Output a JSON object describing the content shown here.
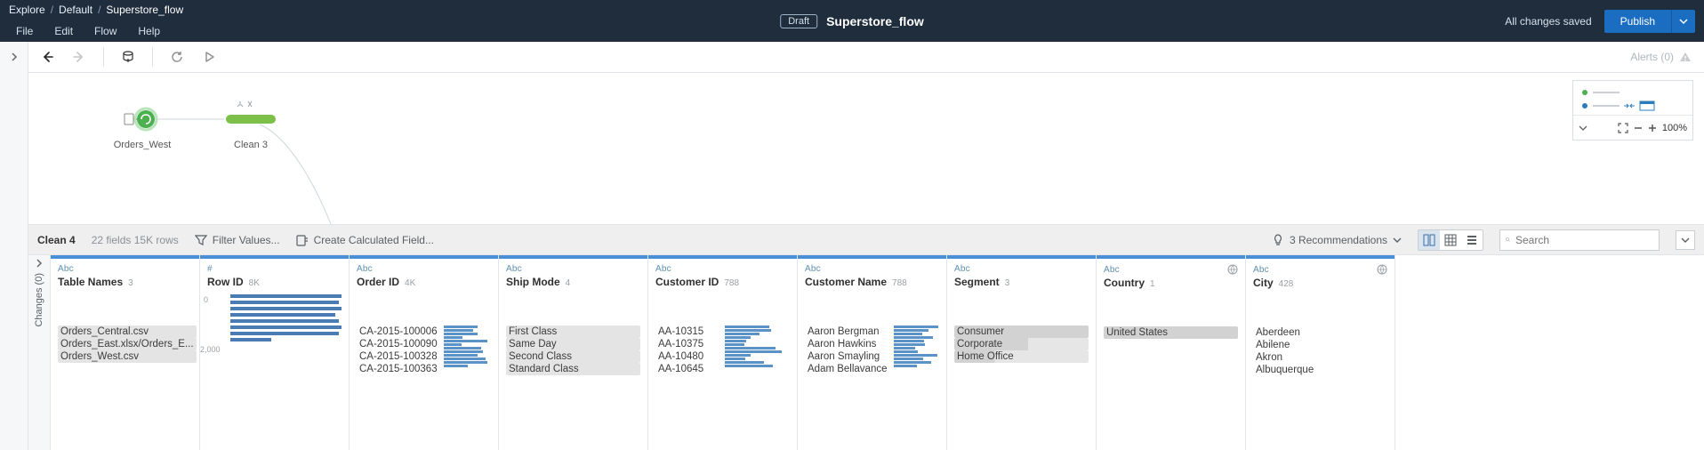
{
  "breadcrumb": {
    "root": "Explore",
    "space": "Default",
    "item": "Superstore_flow"
  },
  "menubar": {
    "file": "File",
    "edit": "Edit",
    "flow": "Flow",
    "help": "Help"
  },
  "header": {
    "draft": "Draft",
    "title": "Superstore_flow",
    "saved": "All changes saved",
    "publish": "Publish"
  },
  "toolbar": {
    "alerts": "Alerts (0)"
  },
  "canvas": {
    "node1": "Orders_West",
    "node2": "Clean 3",
    "zoom": "100%"
  },
  "profile": {
    "step": "Clean 4",
    "meta": "22 fields   15K rows",
    "filter": "Filter Values...",
    "calc": "Create Calculated Field...",
    "recs": "3 Recommendations",
    "search_ph": "Search"
  },
  "changes_label": "Changes (0)",
  "columns": [
    {
      "type": "Abc",
      "name": "Table Names",
      "count": "3",
      "values": [
        "Orders_Central.csv",
        "Orders_East.xlsx/Orders_E...",
        "Orders_West.csv"
      ],
      "selected": [
        0,
        1,
        2
      ]
    },
    {
      "type": "#",
      "name": "Row ID",
      "count": "8K",
      "hist_labels": [
        "0",
        "2,000"
      ],
      "values": []
    },
    {
      "type": "Abc",
      "name": "Order ID",
      "count": "4K",
      "values": [
        "CA-2015-100006",
        "CA-2015-100090",
        "CA-2015-100328",
        "CA-2015-100363"
      ],
      "mini": true
    },
    {
      "type": "Abc",
      "name": "Ship Mode",
      "count": "4",
      "values": [
        "First Class",
        "Same Day",
        "Second Class",
        "Standard Class"
      ],
      "selected": [
        0,
        1,
        2,
        3
      ]
    },
    {
      "type": "Abc",
      "name": "Customer ID",
      "count": "788",
      "values": [
        "AA-10315",
        "AA-10375",
        "AA-10480",
        "AA-10645"
      ],
      "mini": true
    },
    {
      "type": "Abc",
      "name": "Customer Name",
      "count": "788",
      "values": [
        "Aaron Bergman",
        "Aaron Hawkins",
        "Aaron Smayling",
        "Adam Bellavance"
      ],
      "mini": true
    },
    {
      "type": "Abc",
      "name": "Segment",
      "count": "3",
      "values": [
        "Consumer",
        "Corporate",
        "Home Office"
      ],
      "bars": [
        100,
        55,
        30
      ]
    },
    {
      "type": "Abc",
      "name": "Country",
      "count": "1",
      "geo": true,
      "values": [
        "United States"
      ],
      "bars": [
        100
      ]
    },
    {
      "type": "Abc",
      "name": "City",
      "count": "428",
      "geo": true,
      "values": [
        "Aberdeen",
        "Abilene",
        "Akron",
        "Albuquerque"
      ]
    }
  ],
  "chart_data": {
    "type": "bar",
    "field": "Row ID",
    "orientation": "horizontal",
    "ylim": [
      0,
      8000
    ],
    "tick_labels": [
      "0",
      "2,000"
    ],
    "bins": [
      0,
      2000,
      4000,
      6000,
      8000
    ],
    "values": [
      1900,
      1850,
      1900,
      1800,
      1850,
      1900,
      1850,
      700
    ]
  }
}
